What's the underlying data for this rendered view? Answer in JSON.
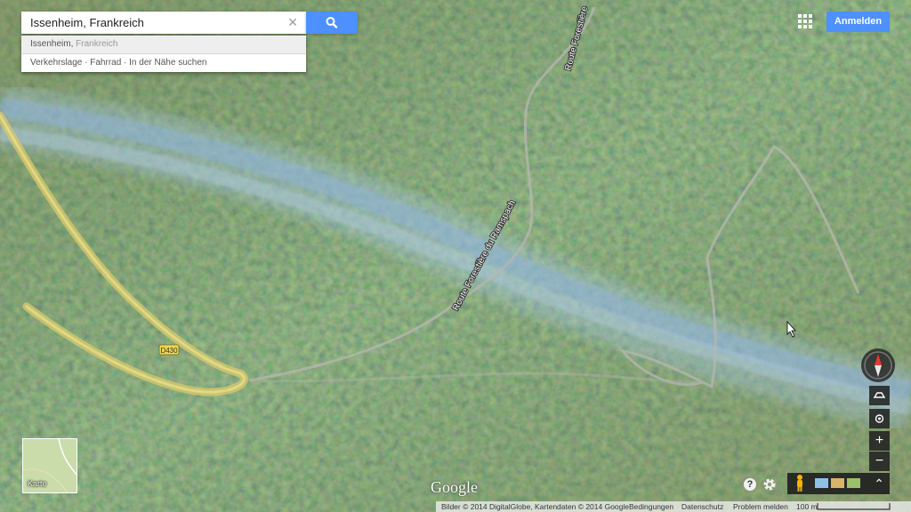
{
  "search": {
    "value": "Issenheim, Frankreich",
    "clear_glyph": "×",
    "suggestions": [
      {
        "main": "Issenheim,",
        "secondary": " Frankreich"
      },
      {
        "main": "Verkehrslage · Fahrrad · In der Nähe suchen",
        "secondary": ""
      }
    ]
  },
  "header": {
    "signin_label": "Anmelden"
  },
  "map": {
    "road_labels": [
      "Route Forestière",
      "Route Forestière du Ramspach"
    ],
    "road_badge": "D430",
    "logo": "Google",
    "minimap_label": "Karte",
    "help_glyph": "?",
    "zoom_in": "+",
    "zoom_out": "−",
    "expand_glyph": "⌃"
  },
  "footer": {
    "imagery": "Bilder © 2014 DigitalGlobe, Kartendaten © 2014 Google",
    "terms": "Bedingungen",
    "privacy": "Datenschutz",
    "report": "Problem melden",
    "scale": "100 m"
  },
  "colors": {
    "accent": "#4d90fe",
    "road_yellow": "#d6c86a",
    "river": "#9cc0e8"
  }
}
